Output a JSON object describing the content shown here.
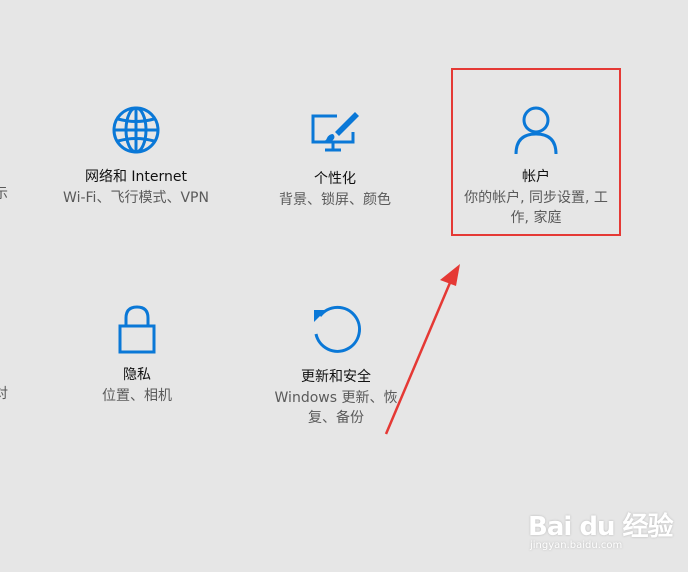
{
  "tiles": {
    "network": {
      "title": "网络和 Internet",
      "desc": "Wi-Fi、飞行模式、VPN",
      "icon": "globe-icon"
    },
    "personalization": {
      "title": "个性化",
      "desc": "背景、锁屏、颜色",
      "icon": "personalization-icon"
    },
    "accounts": {
      "title": "帐户",
      "desc": "你的帐户, 同步设置, 工作, 家庭",
      "icon": "person-icon"
    },
    "privacy": {
      "title": "隐私",
      "desc": "位置、相机",
      "icon": "lock-icon"
    },
    "update": {
      "title": "更新和安全",
      "desc": "Windows 更新、恢复、备份",
      "icon": "refresh-icon"
    }
  },
  "edge": {
    "row1": "示",
    "row2": "对"
  },
  "watermark": {
    "logo": "Bai du 经验",
    "url": "jingyan.baidu.com"
  },
  "colors": {
    "background": "#e6e6e6",
    "accent": "#0a78d7",
    "highlight": "#e53935"
  }
}
